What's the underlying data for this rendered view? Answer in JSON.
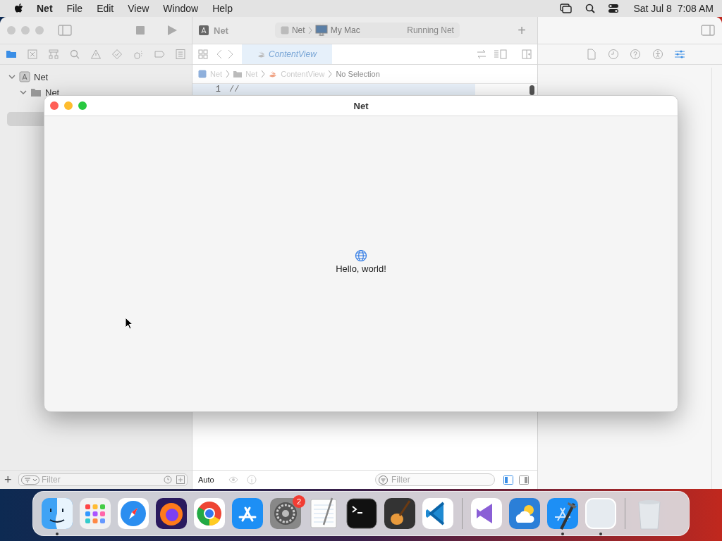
{
  "menu_bar": {
    "app_name": "Net",
    "menus": [
      "File",
      "Edit",
      "View",
      "Window",
      "Help"
    ],
    "clock": "Sat Jul 8  7:08 AM"
  },
  "xcode": {
    "project": "Net",
    "scheme": {
      "target": "Net",
      "destination": "My Mac"
    },
    "status": "Running Net",
    "add_button": "+",
    "navigator_tabs": [
      {
        "kind": "folder",
        "selected": true
      },
      {
        "kind": "xbox",
        "selected": false
      },
      {
        "kind": "hierarchy",
        "selected": false
      },
      {
        "kind": "search",
        "selected": false
      },
      {
        "kind": "warning",
        "selected": false
      },
      {
        "kind": "diamond",
        "selected": false
      },
      {
        "kind": "spray",
        "selected": false
      },
      {
        "kind": "tag",
        "selected": false
      },
      {
        "kind": "list",
        "selected": false
      }
    ],
    "navigator_tree": [
      {
        "label": "Net",
        "expanded": true,
        "children": [
          {
            "label": "Net",
            "expanded": true
          }
        ]
      }
    ],
    "editor_tabs": [
      {
        "label": "ContentView",
        "selected": true
      }
    ],
    "breadcrumb": [
      "Net",
      "Net",
      "ContentView",
      "No Selection"
    ],
    "code_lines": [
      {
        "number": "1",
        "text": "//"
      }
    ],
    "inspector_tabs": [
      {
        "kind": "file",
        "selected": false
      },
      {
        "kind": "clock",
        "selected": false
      },
      {
        "kind": "help",
        "selected": false
      },
      {
        "kind": "accessibility",
        "selected": false
      },
      {
        "kind": "sliders",
        "selected": true
      }
    ],
    "navigator_filter": {
      "placeholder": "Filter"
    },
    "canvas_zoom": "Auto",
    "editor_filter": {
      "placeholder": "Filter"
    }
  },
  "app_window": {
    "title": "Net",
    "message": "Hello, world!"
  },
  "dock": {
    "apps": [
      {
        "kind": "finder",
        "running": true
      },
      {
        "kind": "launchpad",
        "running": false
      },
      {
        "kind": "safari",
        "running": false
      },
      {
        "kind": "firefox",
        "running": false
      },
      {
        "kind": "chrome",
        "running": false
      },
      {
        "kind": "appstore",
        "running": false
      },
      {
        "kind": "settings",
        "running": false,
        "badge": "2"
      },
      {
        "kind": "textedit",
        "running": false
      },
      {
        "kind": "terminal",
        "running": false
      },
      {
        "kind": "garageband",
        "running": false
      },
      {
        "kind": "vscode",
        "running": false
      }
    ],
    "recent": [
      {
        "kind": "visualstudio",
        "running": false
      },
      {
        "kind": "weather",
        "running": false
      },
      {
        "kind": "xcode",
        "running": true
      },
      {
        "kind": "blank",
        "running": true
      }
    ],
    "pinned": [
      {
        "kind": "trash",
        "running": false
      }
    ]
  }
}
